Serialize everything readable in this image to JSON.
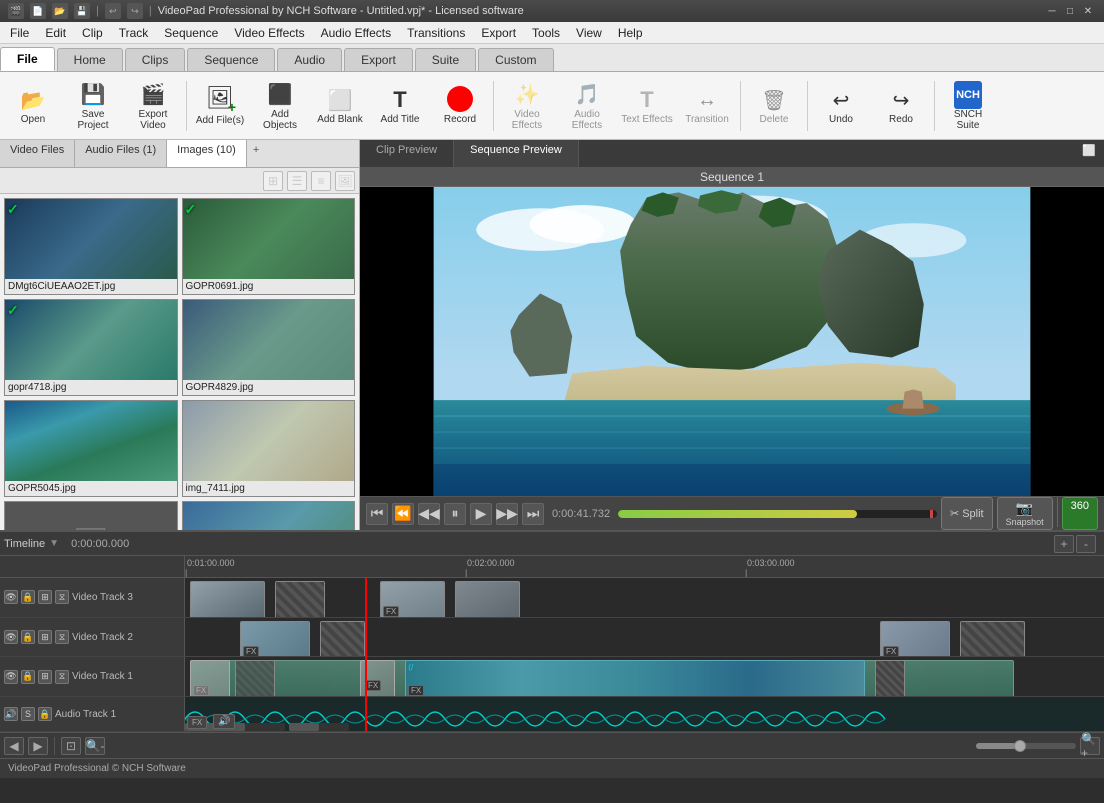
{
  "app": {
    "title": "VideoPad Professional by NCH Software - Untitled.vpj* - Licensed software",
    "copyright": "VideoPad Professional © NCH Software"
  },
  "titlebar": {
    "title": "VideoPad Professional by NCH Software - Untitled.vpj* - Licensed software",
    "icons": [
      "app-icon",
      "new",
      "open",
      "save",
      "undo",
      "redo"
    ],
    "controls": [
      "minimize",
      "maximize",
      "close"
    ]
  },
  "menubar": {
    "items": [
      "File",
      "Edit",
      "Clip",
      "Track",
      "Sequence",
      "Video Effects",
      "Audio Effects",
      "Transitions",
      "Export",
      "Tools",
      "View",
      "Help"
    ]
  },
  "tabbar": {
    "tabs": [
      {
        "label": "File",
        "active": true
      },
      {
        "label": "Home",
        "active": false
      },
      {
        "label": "Clips",
        "active": false
      },
      {
        "label": "Sequence",
        "active": false
      },
      {
        "label": "Audio",
        "active": false
      },
      {
        "label": "Export",
        "active": false
      },
      {
        "label": "Suite",
        "active": false
      },
      {
        "label": "Custom",
        "active": false
      }
    ]
  },
  "toolbar": {
    "buttons": [
      {
        "id": "open",
        "label": "Open",
        "icon": "📂"
      },
      {
        "id": "save-project",
        "label": "Save Project",
        "icon": "💾"
      },
      {
        "id": "export-video",
        "label": "Export Video",
        "icon": "🎬"
      },
      {
        "id": "add-files",
        "label": "Add File(s)",
        "icon": "➕"
      },
      {
        "id": "add-objects",
        "label": "Add Objects",
        "icon": "⬛"
      },
      {
        "id": "add-blank",
        "label": "Add Blank",
        "icon": "⬜"
      },
      {
        "id": "add-title",
        "label": "Add Title",
        "icon": "T"
      },
      {
        "id": "record",
        "label": "Record",
        "icon": "⏺"
      },
      {
        "id": "video-effects",
        "label": "Video Effects",
        "icon": "✨"
      },
      {
        "id": "audio-effects",
        "label": "Audio Effects",
        "icon": "🎵"
      },
      {
        "id": "text-effects",
        "label": "Text Effects",
        "icon": "T"
      },
      {
        "id": "transition",
        "label": "Transition",
        "icon": "↔"
      },
      {
        "id": "delete",
        "label": "Delete",
        "icon": "🗑"
      },
      {
        "id": "undo",
        "label": "Undo",
        "icon": "↩"
      },
      {
        "id": "redo",
        "label": "Redo",
        "icon": "↪"
      },
      {
        "id": "snch-suite",
        "label": "SNCH Suite",
        "icon": "S"
      }
    ]
  },
  "media_panel": {
    "tabs": [
      {
        "label": "Video Files",
        "active": false
      },
      {
        "label": "Audio Files (1)",
        "active": false
      },
      {
        "label": "Images (10)",
        "active": true
      }
    ],
    "items": [
      {
        "filename": "DMgt6CiUEAAO2ET.jpg",
        "checked": true,
        "bg": "bg1"
      },
      {
        "filename": "GOPR0691.jpg",
        "checked": true,
        "bg": "bg2"
      },
      {
        "filename": "gopr4718.jpg",
        "checked": true,
        "bg": "bg3"
      },
      {
        "filename": "GOPR4829.jpg",
        "checked": false,
        "bg": "bg4"
      },
      {
        "filename": "GOPR5045.jpg",
        "checked": false,
        "bg": "bg5"
      },
      {
        "filename": "img_7411.jpg",
        "checked": false,
        "bg": "bg6"
      },
      {
        "filename": "",
        "checked": false,
        "bg": "placeholder"
      },
      {
        "filename": "",
        "checked": false,
        "bg": "placeholder2"
      }
    ]
  },
  "preview": {
    "tabs": [
      "Clip Preview",
      "Sequence Preview"
    ],
    "active_tab": "Sequence Preview",
    "title": "Sequence 1",
    "time": "0:00:41.732",
    "controls": [
      "skip-start",
      "prev-frame",
      "rewind",
      "pause",
      "play",
      "next-frame",
      "skip-end"
    ],
    "buttons": {
      "split": "Split",
      "snapshot": "Snapshot",
      "btn360": "360"
    }
  },
  "timeline": {
    "label": "Timeline",
    "time": "0:00:00.000",
    "ruler": {
      "marks": [
        "0:01:00.000",
        "0:02:00.000",
        "0:03:00.000"
      ]
    },
    "tracks": [
      {
        "name": "Video Track 3",
        "type": "video"
      },
      {
        "name": "Video Track 2",
        "type": "video"
      },
      {
        "name": "Video Track 1",
        "type": "video"
      },
      {
        "name": "Audio Track 1",
        "type": "audio"
      }
    ]
  },
  "statusbar": {
    "text": "VideoPad Professional © NCH Software"
  }
}
